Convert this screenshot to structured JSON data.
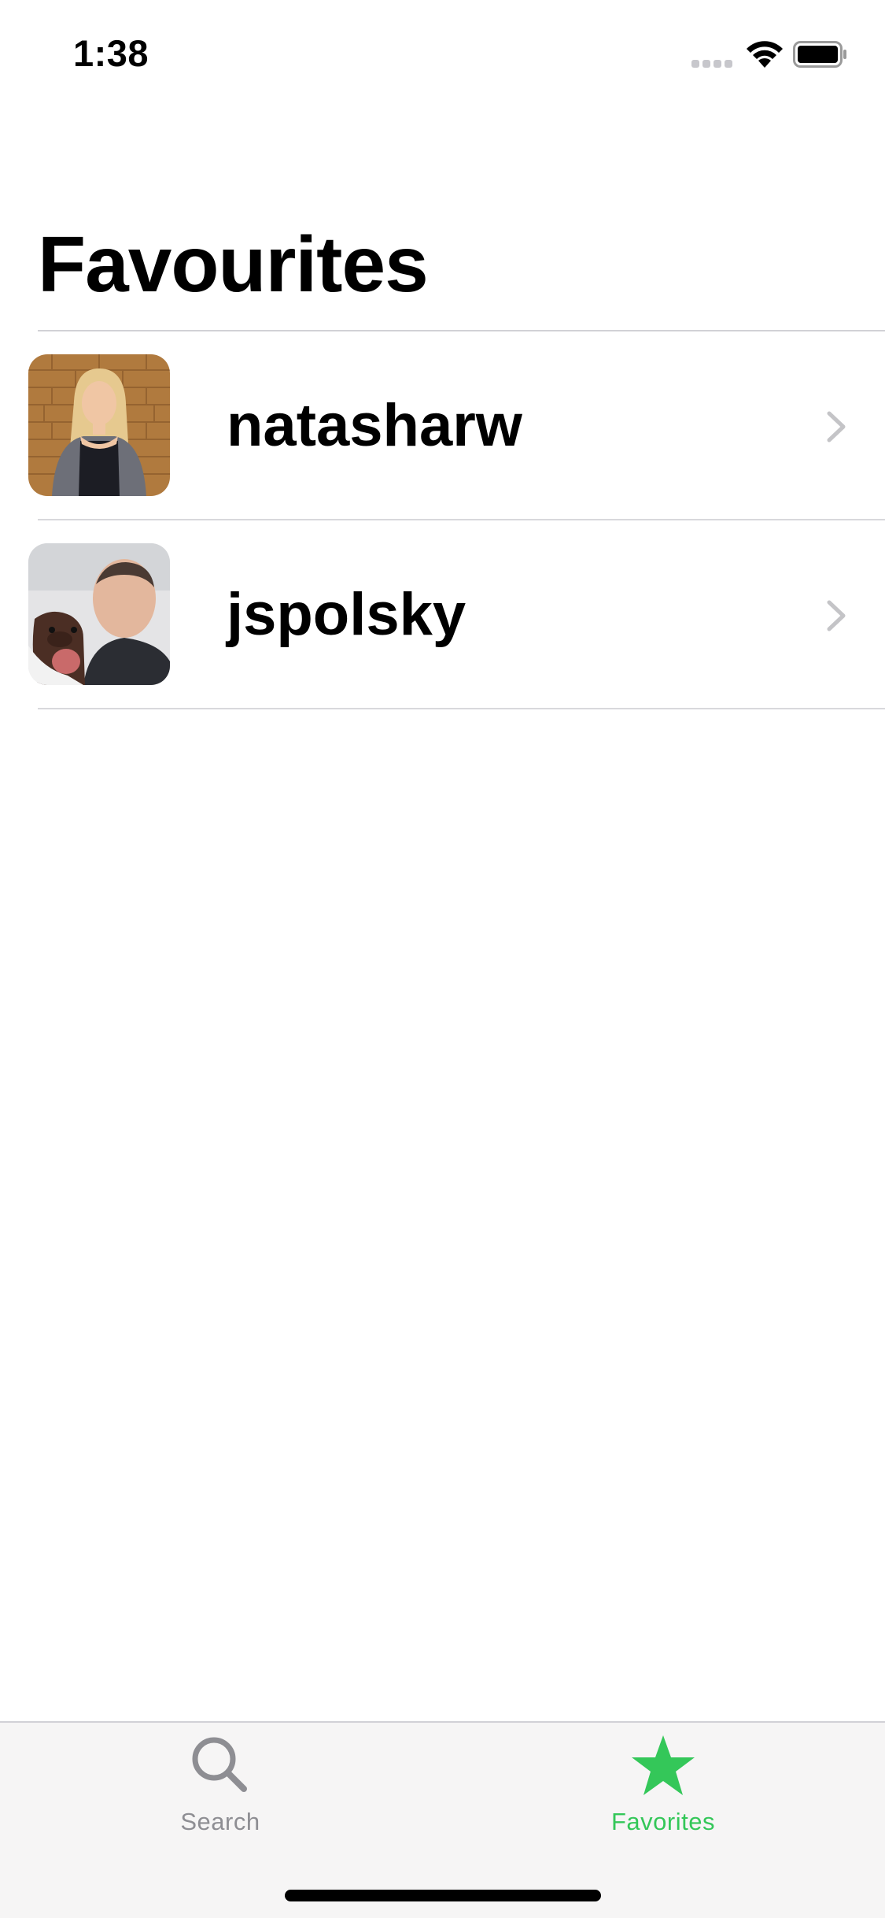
{
  "status_bar": {
    "time": "1:38"
  },
  "page": {
    "title": "Favourites"
  },
  "favorites": [
    {
      "username": "natasharw",
      "avatar_icon": "user-photo-woman-brick-wall"
    },
    {
      "username": "jspolsky",
      "avatar_icon": "user-photo-man-with-dog"
    }
  ],
  "tab_bar": {
    "tabs": [
      {
        "label": "Search",
        "icon": "magnifier-icon",
        "selected": false
      },
      {
        "label": "Favorites",
        "icon": "star-icon",
        "selected": true
      }
    ]
  },
  "colors": {
    "accent": "#34c759",
    "inactive_tab": "#8e8e93",
    "tab_bar_background": "#f6f5f5",
    "separator": "#d1d1d6"
  }
}
